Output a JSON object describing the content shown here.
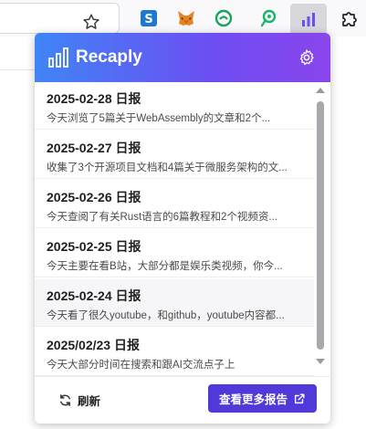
{
  "colors": {
    "header_gradient_start": "#3f85f5",
    "header_gradient_end": "#8a45ec",
    "primary_button": "#4f39d8"
  },
  "browser": {
    "extensions": [
      "star-bookmark-icon",
      "s-extension-icon",
      "metamask-fox-icon",
      "green-circle-extension-icon",
      "green-pin-extension-icon",
      "recaply-chart-icon",
      "puzzle-extensions-icon"
    ]
  },
  "popup": {
    "brand": "Recaply",
    "items": [
      {
        "title": "2025-02-28 日报",
        "desc": "今天浏览了5篇关于WebAssembly的文章和2个..."
      },
      {
        "title": "2025-02-27 日报",
        "desc": "收集了3个开源项目文档和4篇关于微服务架构的文..."
      },
      {
        "title": "2025-02-26 日报",
        "desc": "今天查阅了有关Rust语言的6篇教程和2个视频资..."
      },
      {
        "title": "2025-02-25 日报",
        "desc": "今天主要在看B站，大部分都是娱乐类视频，你今..."
      },
      {
        "title": "2025-02-24 日报",
        "desc": "今天看了很久youtube，和github，youtube内容都..."
      },
      {
        "title": "2025/02/23 日报",
        "desc": "今天大部分时间在搜索和跟AI交流点子上"
      }
    ],
    "footer": {
      "refresh_label": "刷新",
      "more_label": "查看更多报告"
    }
  }
}
